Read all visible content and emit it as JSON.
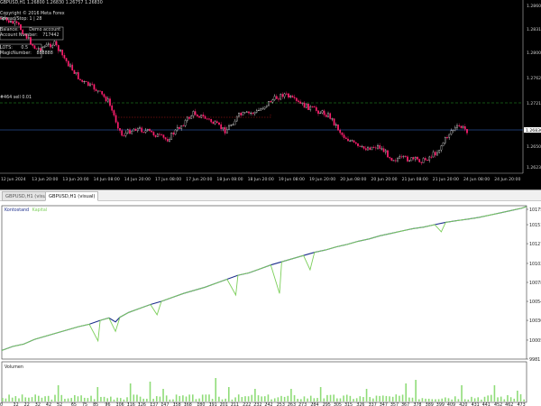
{
  "price_chart": {
    "symbol_line": "GBPUSD,H1  1.26800 1.26830 1.26757 1.26830",
    "copyright": "Copyright © 2016 Meta Forex",
    "spread_line": "Spread/Stop: 1 | 28",
    "balance_label": "Balance:",
    "balance_value": "Demo account",
    "account_label": "Account Number:",
    "account_value": "717442",
    "lots_label": "LOTS:",
    "lots_value": "0.5",
    "magic_label": "MagicNumber:",
    "magic_value": "888888",
    "line_label": "#464 sell 0.01",
    "price_ticks": [
      "1.28600",
      "1.28315",
      "1.28000",
      "1.27620",
      "1.27210",
      "1.26830",
      "1.26500",
      "1.26230"
    ],
    "time_ticks": [
      "12 Jun 2024",
      "13 Jun 20:00",
      "13 Jun 20:00",
      "14 Jun 08:00",
      "14 Jun 20:00",
      "17 Jun 08:00",
      "17 Jun 20:00",
      "18 Jun 08:00",
      "18 Jun 20:00",
      "19 Jun 08:00",
      "19 Jun 20:00",
      "20 Jun 08:00",
      "20 Jun 20:00",
      "21 Jun 08:00",
      "21 Jun 20:00",
      "24 Jun 08:00",
      "24 Jun 20:00"
    ],
    "colors": {
      "bg": "#000000",
      "bull": "#ffffff",
      "bear": "#ff1e6e",
      "grid_green": "#2aa02a",
      "grid_blue": "#3a6fd8",
      "red_level": "#c01818"
    }
  },
  "tabs": [
    {
      "label": "GBPUSD,H1 (visual)",
      "active": false
    },
    {
      "label": "GBPUSD,H1 (visual)",
      "active": true
    }
  ],
  "equity_chart": {
    "legend_balance": "Kontostand",
    "legend_equity": "Kapital",
    "volume_label": "Volumen",
    "colors": {
      "balance": "#1d2f8c",
      "equity": "#7ccf5a",
      "volume": "#8fdc78"
    },
    "y_ticks": [
      "10175",
      "10151",
      "10127",
      "10102",
      "10078",
      "10054",
      "10030",
      "10005",
      "9981"
    ],
    "x_ticks": [
      "0",
      "12",
      "22",
      "32",
      "42",
      "52",
      "65",
      "75",
      "85",
      "96",
      "106",
      "116",
      "126",
      "137",
      "147",
      "158",
      "168",
      "180",
      "191",
      "201",
      "211",
      "222",
      "232",
      "242",
      "253",
      "263",
      "273",
      "284",
      "295",
      "305",
      "315",
      "326",
      "337",
      "347",
      "357",
      "367",
      "378",
      "389",
      "399",
      "409",
      "420",
      "431",
      "441",
      "452",
      "462",
      "473"
    ],
    "chart_data": {
      "type": "line",
      "x_label": "",
      "y_label": "",
      "ylim": [
        9981,
        10175
      ],
      "xlim": [
        0,
        480
      ],
      "series": [
        {
          "name": "Kontostand",
          "points": [
            [
              0,
              9992
            ],
            [
              10,
              9997
            ],
            [
              20,
              10000
            ],
            [
              30,
              10006
            ],
            [
              40,
              10010
            ],
            [
              50,
              10014
            ],
            [
              60,
              10018
            ],
            [
              70,
              10022
            ],
            [
              80,
              10025
            ],
            [
              90,
              10030
            ],
            [
              98,
              10033
            ],
            [
              104,
              10028
            ],
            [
              108,
              10034
            ],
            [
              116,
              10040
            ],
            [
              126,
              10045
            ],
            [
              136,
              10050
            ],
            [
              146,
              10054
            ],
            [
              156,
              10059
            ],
            [
              166,
              10064
            ],
            [
              176,
              10068
            ],
            [
              186,
              10072
            ],
            [
              196,
              10077
            ],
            [
              206,
              10082
            ],
            [
              216,
              10087
            ],
            [
              226,
              10090
            ],
            [
              236,
              10095
            ],
            [
              246,
              10100
            ],
            [
              256,
              10104
            ],
            [
              266,
              10108
            ],
            [
              276,
              10112
            ],
            [
              286,
              10116
            ],
            [
              296,
              10119
            ],
            [
              306,
              10123
            ],
            [
              316,
              10126
            ],
            [
              326,
              10130
            ],
            [
              336,
              10133
            ],
            [
              346,
              10137
            ],
            [
              356,
              10140
            ],
            [
              366,
              10143
            ],
            [
              376,
              10146
            ],
            [
              386,
              10148
            ],
            [
              396,
              10151
            ],
            [
              406,
              10154
            ],
            [
              416,
              10156
            ],
            [
              426,
              10158
            ],
            [
              436,
              10160
            ],
            [
              446,
              10163
            ],
            [
              456,
              10166
            ],
            [
              466,
              10169
            ],
            [
              476,
              10172
            ],
            [
              480,
              10174
            ]
          ]
        },
        {
          "name": "Kapital",
          "points": [
            [
              0,
              9992
            ],
            [
              10,
              9997
            ],
            [
              20,
              10000
            ],
            [
              30,
              10006
            ],
            [
              40,
              10010
            ],
            [
              50,
              10014
            ],
            [
              60,
              10018
            ],
            [
              70,
              10022
            ],
            [
              80,
              10025
            ],
            [
              88,
              10004
            ],
            [
              90,
              10030
            ],
            [
              98,
              10033
            ],
            [
              104,
              10016
            ],
            [
              108,
              10034
            ],
            [
              116,
              10040
            ],
            [
              126,
              10045
            ],
            [
              136,
              10050
            ],
            [
              142,
              10037
            ],
            [
              146,
              10054
            ],
            [
              156,
              10059
            ],
            [
              166,
              10064
            ],
            [
              176,
              10068
            ],
            [
              186,
              10072
            ],
            [
              196,
              10077
            ],
            [
              206,
              10082
            ],
            [
              214,
              10062
            ],
            [
              216,
              10087
            ],
            [
              226,
              10090
            ],
            [
              236,
              10095
            ],
            [
              246,
              10100
            ],
            [
              254,
              10064
            ],
            [
              256,
              10104
            ],
            [
              266,
              10108
            ],
            [
              276,
              10112
            ],
            [
              282,
              10094
            ],
            [
              286,
              10116
            ],
            [
              296,
              10119
            ],
            [
              306,
              10123
            ],
            [
              316,
              10126
            ],
            [
              326,
              10130
            ],
            [
              336,
              10133
            ],
            [
              346,
              10137
            ],
            [
              356,
              10140
            ],
            [
              366,
              10143
            ],
            [
              376,
              10146
            ],
            [
              386,
              10148
            ],
            [
              396,
              10151
            ],
            [
              402,
              10142
            ],
            [
              406,
              10154
            ],
            [
              416,
              10156
            ],
            [
              426,
              10158
            ],
            [
              436,
              10160
            ],
            [
              446,
              10163
            ],
            [
              456,
              10166
            ],
            [
              466,
              10169
            ],
            [
              476,
              10172
            ],
            [
              480,
              10174
            ]
          ]
        }
      ]
    }
  }
}
